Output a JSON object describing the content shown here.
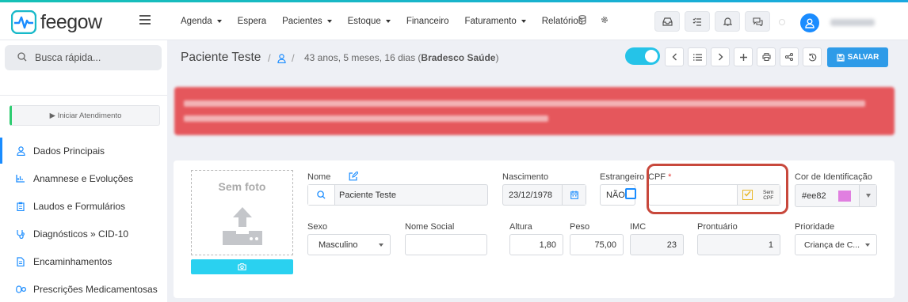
{
  "app": {
    "logo_text": "feegow"
  },
  "nav": {
    "items": [
      {
        "label": "Agenda",
        "caret": true
      },
      {
        "label": "Espera",
        "caret": false
      },
      {
        "label": "Pacientes",
        "caret": true
      },
      {
        "label": "Estoque",
        "caret": true
      },
      {
        "label": "Financeiro",
        "caret": false
      },
      {
        "label": "Faturamento",
        "caret": true
      },
      {
        "label": "Relatórios",
        "caret": false
      }
    ]
  },
  "sidebar": {
    "search_placeholder": "Busca rápida...",
    "start_button": "▶ Iniciar Atendimento",
    "items": [
      {
        "label": "Dados Principais",
        "icon": "user-icon"
      },
      {
        "label": "Anamnese e Evoluções",
        "icon": "chart-icon"
      },
      {
        "label": "Laudos e Formulários",
        "icon": "clipboard-icon"
      },
      {
        "label": "Diagnósticos » CID-10",
        "icon": "stethoscope-icon"
      },
      {
        "label": "Encaminhamentos",
        "icon": "document-icon"
      },
      {
        "label": "Prescrições Medicamentosas",
        "icon": "pills-icon"
      }
    ]
  },
  "header": {
    "title": "Paciente Teste",
    "separator": "/",
    "subtitle_prefix": "43 anos, 5 meses, 16 dias (",
    "subtitle_bold": "Bradesco Saúde",
    "subtitle_suffix": ")",
    "save_label": "SALVAR"
  },
  "form": {
    "photo_label": "Sem foto",
    "nome_label": "Nome",
    "nome_value": "Paciente Teste",
    "nascimento_label": "Nascimento",
    "nascimento_value": "23/12/1978",
    "estrangeiro_label": "Estrangeiro",
    "estrangeiro_value": "NÃO",
    "cpf_label": "CPF",
    "cpf_required": "*",
    "sem_cpf_line1": "Sem",
    "sem_cpf_line2": "CPF",
    "cor_label": "Cor de Identificação",
    "cor_value": "#ee82",
    "cor_swatch": "#e07fe0",
    "sexo_label": "Sexo",
    "sexo_value": "Masculino",
    "nome_social_label": "Nome Social",
    "altura_label": "Altura",
    "altura_value": "1,80",
    "peso_label": "Peso",
    "peso_value": "75,00",
    "imc_label": "IMC",
    "imc_value": "23",
    "prontuario_label": "Prontuário",
    "prontuario_value": "1",
    "prioridade_label": "Prioridade",
    "prioridade_value": "Criança de C..."
  },
  "colors": {
    "accent": "#1a8cff",
    "alert": "#e5575c",
    "toggle": "#25c3e8",
    "save": "#2e9be8",
    "highlight": "#c8483c"
  }
}
